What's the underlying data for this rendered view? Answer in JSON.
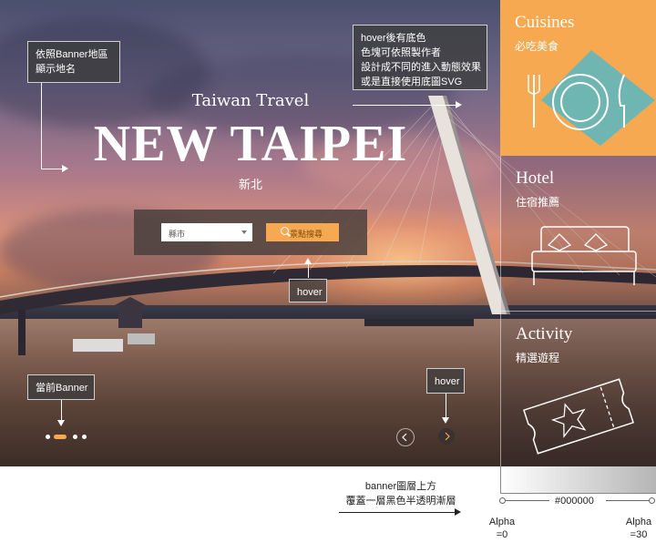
{
  "hero": {
    "subtitle": "Taiwan Travel",
    "title": "NEW TAIPEI",
    "title_zh": "新北"
  },
  "search": {
    "select_value": "縣市",
    "button_label": "景點搜尋"
  },
  "slider": {
    "dot_count": 4,
    "active_index": 1
  },
  "annotations": {
    "banner_location": "依照Banner地區\n顯示地名",
    "hover_bg": "hover後有底色\n色塊可依照製作者\n設計成不同的進入動態效果\n或是直接使用底圖SVG",
    "hover_search": "hover",
    "current_banner": "當前Banner",
    "hover_nav": "hover",
    "overlay_note": "banner圖層上方\n覆蓋一層黑色半透明漸層",
    "color_label": "#000000",
    "alpha_start": "Alpha\n=0",
    "alpha_end": "Alpha\n=30"
  },
  "panels": [
    {
      "title": "Cuisines",
      "subtitle": "必吃美食",
      "bg": "#f6a950",
      "icon": "dining-icon"
    },
    {
      "title": "Hotel",
      "subtitle": "住宿推薦",
      "bg": "transparent",
      "icon": "bed-icon"
    },
    {
      "title": "Activity",
      "subtitle": "精選遊程",
      "bg": "transparent",
      "icon": "ticket-icon"
    }
  ],
  "colors": {
    "accent": "#f6a950",
    "teal": "#6fb6b3"
  }
}
